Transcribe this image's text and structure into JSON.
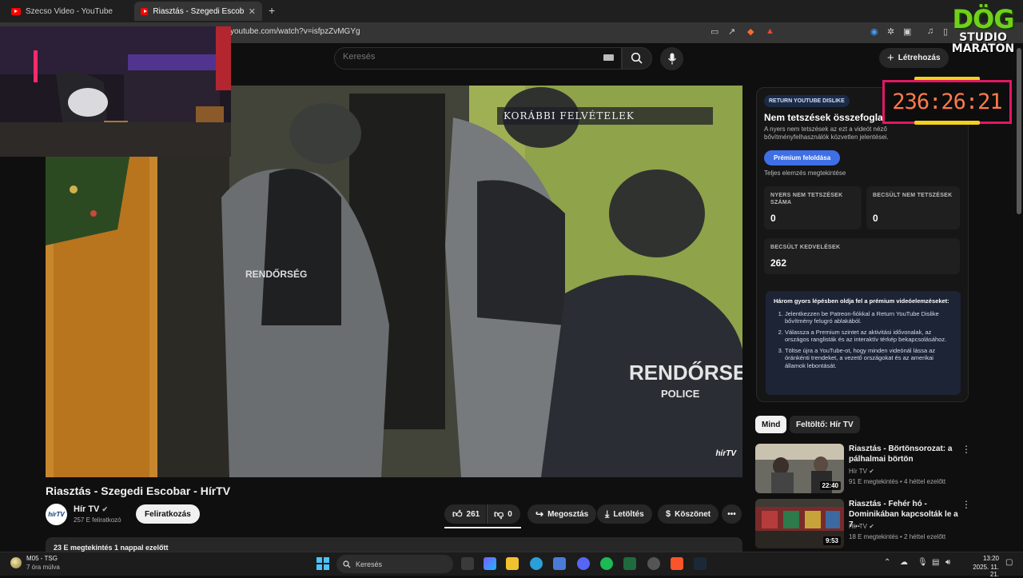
{
  "browser": {
    "tabs": [
      {
        "title": "Szecso Video - YouTube"
      },
      {
        "title": "Riasztás - Szegedi Escobar - Hír"
      }
    ],
    "url": "youtube.com/watch?v=isfpzZvMGYg"
  },
  "header": {
    "search_placeholder": "Keresés",
    "create_label": "Létrehozás"
  },
  "video": {
    "overlay_caption": "KORÁBBI FELVÉTELEK",
    "watermark": "hírTV",
    "title": "Riasztás - Szegedi Escobar - HírTV",
    "channel_avatar_text": "hírTV",
    "channel": "Hír TV",
    "subscribers": "257 E feliratkozó",
    "subscribe_label": "Feliratkozás",
    "likes": "261",
    "dislikes": "0",
    "share_label": "Megosztás",
    "download_label": "Letöltés",
    "thanks_label": "Köszönet",
    "description_meta": "23 E megtekintés  1 nappal ezelőtt"
  },
  "ryd": {
    "badge": "RETURN YOUTUBE DISLIKE",
    "title": "Nem tetszések összefoglalója",
    "desc": "A nyers nem tetszések az ezt a videót néző bővítményfelhasználók közvetlen jelentései.",
    "premium_button": "Prémium feloldása",
    "analysis": "Teljes elemzés megtekintése",
    "stats": [
      {
        "label": "NYERS NEM TETSZÉSEK SZÁMA",
        "value": "0"
      },
      {
        "label": "BECSÜLT NEM TETSZÉSEK",
        "value": "0"
      },
      {
        "label": "BECSÜLT KEDVELÉSEK",
        "value": "262"
      }
    ],
    "steps_title": "Három gyors lépésben oldja fel a prémium videóelemzéseket:",
    "steps": [
      "Jelentkezzen be Patreon-fiókkal a Return YouTube Dislike bővítmény felugró ablakából.",
      "Válassza a Premium szintet az aktivitási idővonalak, az országos ranglisták és az interaktív térkép bekapcsolásához.",
      "Töltse újra a YouTube-ot, hogy minden videónál lássa az óránkénti trendeket, a vezető országokat és az amerikai államok lebontását."
    ]
  },
  "overlay": {
    "timer": "236:26:21",
    "logo_line1": "DÖG",
    "logo_line2": "STUDIO",
    "logo_line3": "MARATON"
  },
  "chips": [
    "Mind",
    "Feltöltő: Hír TV"
  ],
  "recommendations": [
    {
      "title": "Riasztás - Börtönsorozat: a pálhalmai börtön",
      "channel": "Hír TV",
      "meta": "91 E megtekintés • 4 héttel ezelőtt",
      "duration": "22:40"
    },
    {
      "title": "Riasztás - Fehér hó - Dominikában kapcsolták le a 7...",
      "channel": "Hír TV",
      "meta": "18 E megtekintés • 2 héttel ezelőtt",
      "duration": "9:53"
    }
  ],
  "taskbar": {
    "news_title": "M05 - TSG",
    "news_sub": "7 óra múlva",
    "search_label": "Keresés",
    "time": "13:20",
    "date": "2025. 11. 21."
  },
  "colors": {
    "accent": "#3f6fe6",
    "yt_red": "#ff0000",
    "timer_border": "#e01862",
    "timer_text": "#ff7a4a",
    "logo_green": "#6fd11a"
  }
}
